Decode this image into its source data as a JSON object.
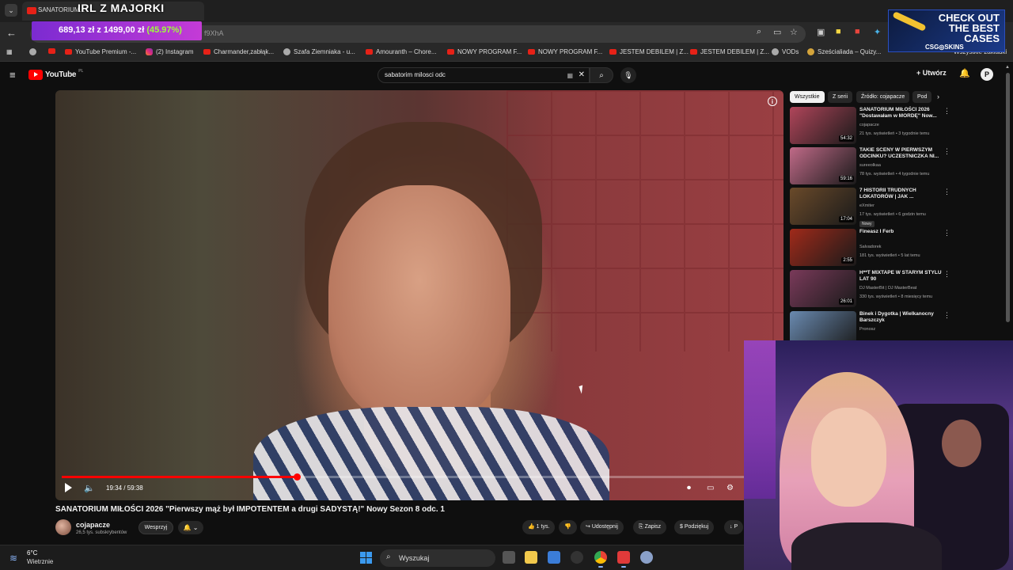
{
  "browser": {
    "tab_title": "SANATORIUM...",
    "stream_overlay_title": "IRL Z MAJORKI",
    "url_fragment": "f9XhA",
    "donation": {
      "amount": "689,13 zł z 1499,00 zł",
      "percent": "(45.97%)"
    },
    "bookmarks": [
      "YouTube Premium -...",
      "(2) Instagram",
      "Charmander,zabłąk...",
      "Szafa Ziemniaka - u...",
      "Amouranth – Chore...",
      "NOWY PROGRAM F...",
      "NOWY PROGRAM F...",
      "JESTEM DEBILEM | Z...",
      "JESTEM DEBILEM | Z...",
      "VODs",
      "Sześcialiada – Quizy..."
    ],
    "bookmarks_overflow": "Wszystkie zakładki"
  },
  "ad": {
    "lines": [
      "CHECK OUT",
      "THE BEST",
      "CASES"
    ],
    "brand": "CSG◎SKINS",
    "accent": "#f2c230"
  },
  "youtube": {
    "logo": "YouTube",
    "region": "PL",
    "search_query": "sabatorim milosci odc",
    "create_label": "Utwórz",
    "account_initial": "P"
  },
  "player": {
    "time": "19:34 / 59:38",
    "progress_fraction": 0.328
  },
  "video": {
    "title": "SANATORIUM MIŁOŚCI 2026 \"Pierwszy mąż był IMPOTENTEM a drugi SADYSTĄ!\" Nowy Sezon 8 odc. 1",
    "channel": "cojapacze",
    "subscribers": "26,5 tys. subskrybentów",
    "support_label": "Wesprzyj",
    "likes": "1 tys.",
    "share_label": "Udostępnij",
    "save_label": "Zapisz",
    "thanks_label": "Podziękuj",
    "more_label": "P"
  },
  "sidebar": {
    "chips": [
      "Wszystkie",
      "Z serii",
      "Źródło: cojapacze",
      "Pod"
    ],
    "recommendations": [
      {
        "title": "SANATORIUM MIŁOŚCI 2026 \"Dostawałam w MORDĘ\" Now...",
        "channel": "cojapacze",
        "meta": "21 tys. wyświetleń • 3 tygodnie temu",
        "duration": "54:32",
        "thumb_color": "#b0455a"
      },
      {
        "title": "TAKIE SCENY W PIERWSZYM ODCINKU? UCZESTNICZKA NI...",
        "channel": "sureeolkaa",
        "meta": "78 tys. wyświetleń • 4 tygodnie temu",
        "duration": "59:16",
        "thumb_color": "#c06a88"
      },
      {
        "title": "7 HISTORII TRUDNYCH LOKATORÓW | JAK ...",
        "channel": "eXmiter",
        "meta": "17 tys. wyświetleń • 6 godzin temu",
        "duration": "17:04",
        "thumb_color": "#6a4a2a",
        "badge": "Nowy"
      },
      {
        "title": "Fineasz I Ferb",
        "channel": "Salvadorek",
        "meta": "181 tys. wyświetleń • 5 lat temu",
        "duration": "2:55",
        "thumb_color": "#a02a1a"
      },
      {
        "title": "H**T MIXTAPE W STARYM STYLU LAT 90",
        "channel": "DJ MasterBit | DJ MasterBeat",
        "meta": "330 tys. wyświetleń • 8 miesięcy temu",
        "duration": "26:01",
        "thumb_color": "#7a3a5a"
      },
      {
        "title": "Binek i Dygotka | Wielkanocny Barszczyk",
        "channel": "Pronosz",
        "meta": "",
        "duration": "",
        "thumb_color": "#6a8ab0"
      }
    ]
  },
  "taskbar": {
    "temperature": "6°C",
    "weather": "Wietrznie",
    "search_placeholder": "Wyszukaj"
  }
}
